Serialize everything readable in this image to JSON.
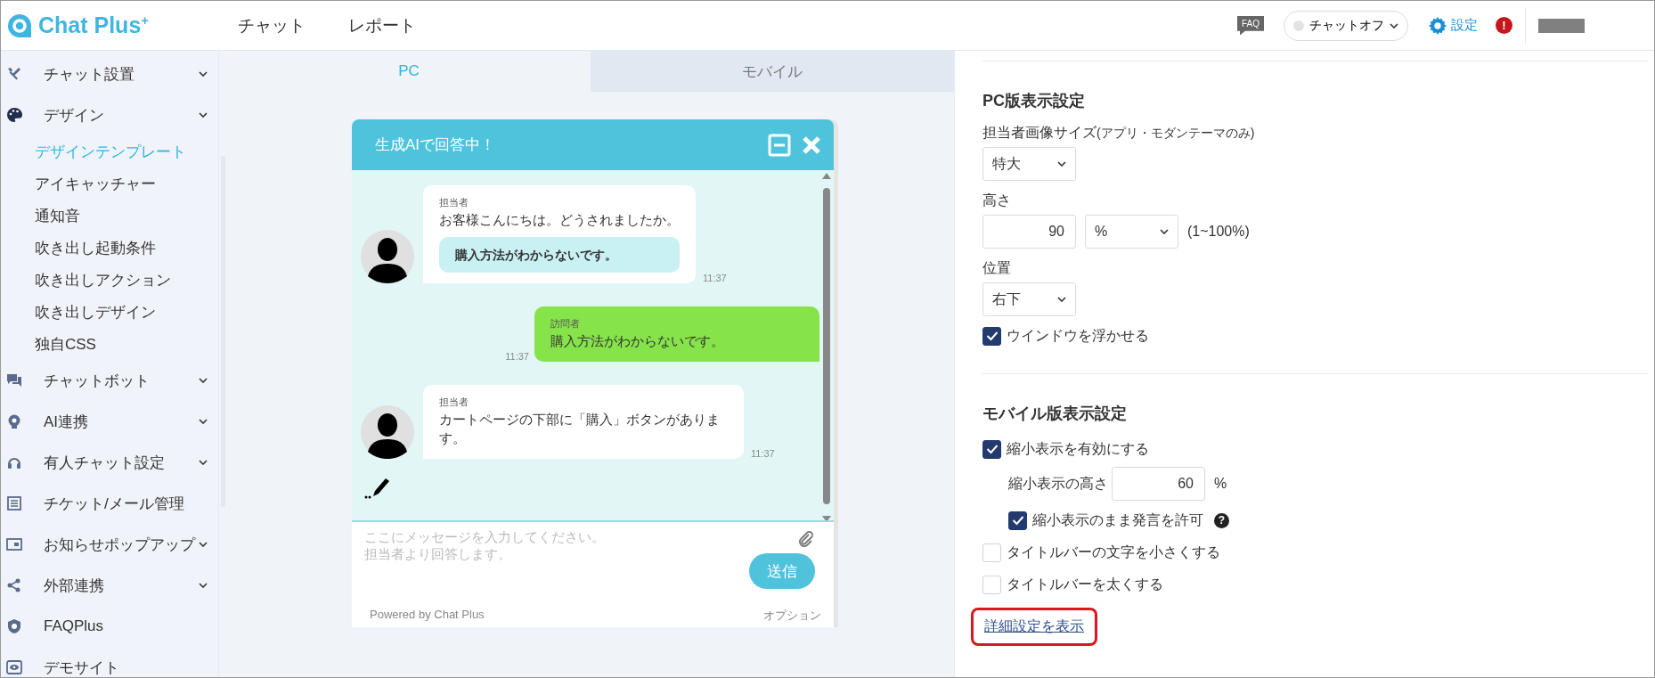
{
  "header": {
    "logo": "Chat Plus$^{+}$",
    "nav": [
      {
        "label": "チャット"
      },
      {
        "label": "レポート"
      }
    ],
    "faq": "FAQ",
    "status": {
      "label": "チャットオフ",
      "online": false
    },
    "settings": "設定",
    "alert": "!"
  },
  "sidebar": {
    "items": [
      {
        "label": "チャット設置",
        "kind": "group"
      },
      {
        "label": "デザイン",
        "kind": "group",
        "children": [
          {
            "label": "デザインテンプレート",
            "selected": true
          },
          {
            "label": "アイキャッチャー",
            "selected": false
          },
          {
            "label": "通知音",
            "selected": false
          },
          {
            "label": "吹き出し起動条件",
            "selected": false
          },
          {
            "label": "吹き出しアクション",
            "selected": false
          },
          {
            "label": "吹き出しデザイン",
            "selected": false
          },
          {
            "label": "独自CSS",
            "selected": false
          }
        ]
      },
      {
        "label": "チャットボット",
        "kind": "group"
      },
      {
        "label": "AI連携",
        "kind": "group"
      },
      {
        "label": "有人チャット設定",
        "kind": "group"
      },
      {
        "label": "チケット/メール管理",
        "kind": "link"
      },
      {
        "label": "お知らせポップアップ",
        "kind": "group"
      },
      {
        "label": "外部連携",
        "kind": "group"
      },
      {
        "label": "FAQPlus",
        "kind": "link"
      },
      {
        "label": "デモサイト",
        "kind": "link"
      }
    ]
  },
  "preview_tabs": [
    {
      "label": "PC",
      "selected": true
    },
    {
      "label": "モバイル",
      "selected": false
    }
  ],
  "chat_widget": {
    "title": "生成AIで回答中！",
    "messages": [
      {
        "kind": "agent",
        "sender": "担当者",
        "text": "お客様こんにちは。どうされましたか。",
        "quick_reply": "購入方法がわからないです。",
        "time": "11:37"
      },
      {
        "kind": "visitor",
        "sender": "訪問者",
        "text": "購入方法がわからないです。",
        "time": "11:37"
      },
      {
        "kind": "agent",
        "sender": "担当者",
        "text": "カートページの下部に「購入」ボタンがあります。",
        "time": "11:37"
      }
    ],
    "typing": true,
    "input_placeholder": "ここにメッセージを入力してください。担当者より回答します。",
    "send": "送信",
    "powered_by": "Powered by Chat Plus",
    "options": "オプション"
  },
  "pc_settings": {
    "heading": "PC版表示設定",
    "image_size": {
      "label": "担当者画像サイズ",
      "note": "(アプリ・モダンテーマのみ)",
      "value": "特大"
    },
    "height": {
      "label": "高さ",
      "value": "90",
      "unit": "%",
      "range": "(1~100%)"
    },
    "position": {
      "label": "位置",
      "value": "右下"
    },
    "float": {
      "label": "ウインドウを浮かせる",
      "checked": true
    }
  },
  "mobile_settings": {
    "heading": "モバイル版表示設定",
    "options": [
      {
        "kind": "checkbox",
        "label": "縮小表示を有効にする",
        "checked": true,
        "children": [
          {
            "kind": "number",
            "label": "縮小表示の高さ",
            "value": "60",
            "unit": "%"
          },
          {
            "kind": "checkbox",
            "label": "縮小表示のまま発言を許可",
            "checked": true,
            "help": "?"
          }
        ]
      },
      {
        "kind": "checkbox",
        "label": "タイトルバーの文字を小さくする",
        "checked": false
      },
      {
        "kind": "checkbox",
        "label": "タイトルバーを太くする",
        "checked": false
      }
    ]
  },
  "details_link": {
    "label": "詳細設定を表示",
    "highlighted": true
  }
}
